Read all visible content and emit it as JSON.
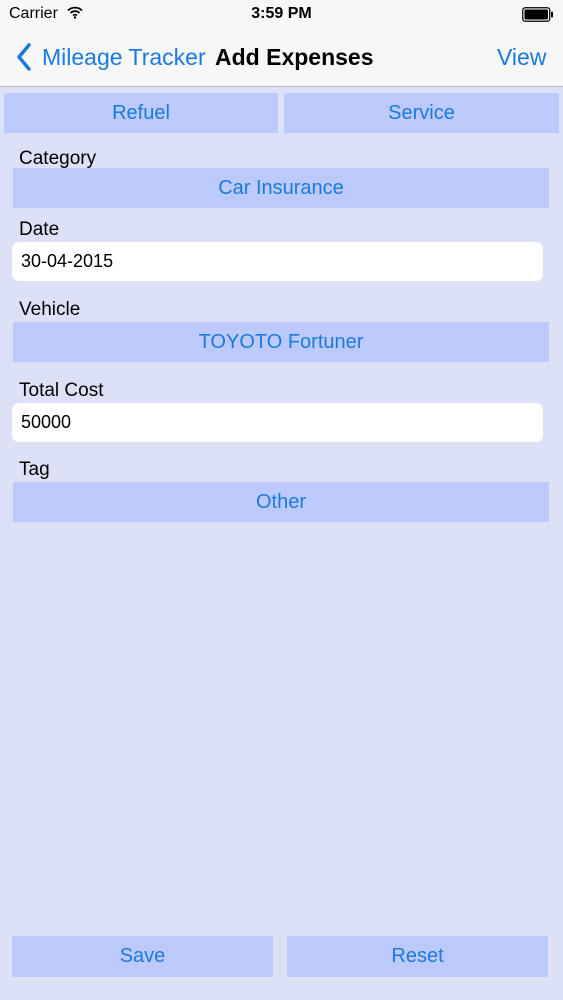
{
  "status_bar": {
    "carrier": "Carrier",
    "time": "3:59 PM"
  },
  "nav": {
    "back_label": "Mileage Tracker",
    "title": "Add Expenses",
    "right_label": "View"
  },
  "tabs": {
    "refuel": "Refuel",
    "service": "Service"
  },
  "form": {
    "category_label": "Category",
    "category_value": "Car Insurance",
    "date_label": "Date",
    "date_value": "30-04-2015",
    "vehicle_label": "Vehicle",
    "vehicle_value": "TOYOTO Fortuner",
    "total_cost_label": "Total Cost",
    "total_cost_value": "50000",
    "tag_label": "Tag",
    "tag_value": "Other"
  },
  "actions": {
    "save": "Save",
    "reset": "Reset"
  },
  "colors": {
    "accent": "#1a7ae0",
    "background": "#dde1f8",
    "button": "#bccafb"
  },
  "icons": {
    "wifi": "wifi-icon",
    "battery": "battery-icon",
    "back": "chevron-left-icon"
  }
}
